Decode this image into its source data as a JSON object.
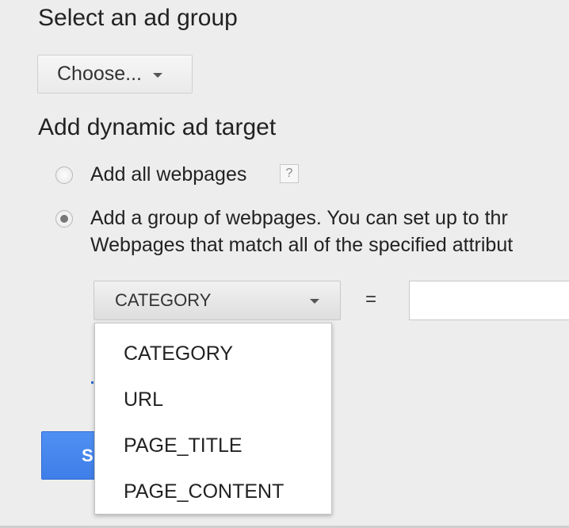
{
  "ad_group": {
    "heading": "Select an ad group",
    "choose_label": "Choose..."
  },
  "target": {
    "heading": "Add dynamic ad target",
    "option_all": {
      "label": "Add all webpages",
      "help_glyph": "?",
      "selected": false
    },
    "option_group": {
      "label_line1": "Add a group of webpages. You can set up to thr",
      "label_line2": "Webpages that match all of the specified attribut",
      "selected": true
    }
  },
  "condition": {
    "attribute_selected": "CATEGORY",
    "operator": "=",
    "value": "",
    "options": [
      "CATEGORY",
      "URL",
      "PAGE_TITLE",
      "PAGE_CONTENT"
    ]
  },
  "primary_button": {
    "label": "S"
  },
  "colors": {
    "background": "#ededed",
    "primary_blue": "#4485f0",
    "text": "#222222"
  },
  "icons": {
    "dropdown_arrow": "chevron-down-icon",
    "help": "question-mark-icon"
  }
}
